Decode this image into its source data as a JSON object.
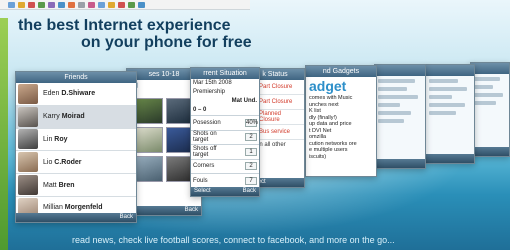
{
  "headline": {
    "line1": "the best Internet experience",
    "line2": "on your phone for free"
  },
  "footer": "read news, check live football scores, connect to facebook, and more on the go...",
  "friends_screen": {
    "title": "Friends",
    "back_label": "Back",
    "items": [
      {
        "first": "Eden",
        "last": "D.Shiware"
      },
      {
        "first": "Karry",
        "last": "Moirad"
      },
      {
        "first": "Lin",
        "last": "Roy"
      },
      {
        "first": "Lio",
        "last": "C.Roder"
      },
      {
        "first": "Matt",
        "last": "Bren"
      },
      {
        "first": "Millian",
        "last": "Morgenfeld"
      }
    ]
  },
  "photos_screen": {
    "title": "ses 10-18",
    "back_label": "Back"
  },
  "football_screen": {
    "title": "rrent Situation",
    "date": "Mar 15th 2008",
    "league": "Premiership",
    "teams_label": "Mat Und.",
    "score": "0 – 0",
    "stats": [
      {
        "label": "Posession",
        "value": "40%"
      },
      {
        "label": "Shots on target",
        "value": "2"
      },
      {
        "label": "Shots off target",
        "value": "1"
      },
      {
        "label": "Corners",
        "value": "2"
      },
      {
        "label": "Fouls",
        "value": "7"
      }
    ],
    "select_label": "Select",
    "back_label": "Back"
  },
  "status_screen": {
    "title": "k Status",
    "items": [
      {
        "text": "Part Closure",
        "color": "#cc3a2a"
      },
      {
        "text": "Part Closure",
        "color": "#e08a2a"
      },
      {
        "text": "Planned Closure",
        "color": "#3a73c8"
      },
      {
        "text": "Bus service",
        "color": "#7a3fa6"
      }
    ],
    "more": "ce on all other",
    "select_label": "Select"
  },
  "gadget_screen": {
    "title": "nd Gadgets",
    "logo": "adget",
    "lines": [
      "comes with Music",
      "unches next",
      "K list",
      "dly (finally!)",
      "up data and price",
      "t DVI Net",
      "omzilla",
      "cution networks ore",
      "e multiple users",
      "iscuits)"
    ]
  },
  "colors": {
    "headline": "#123f5e",
    "accent_blue": "#2d8fc9"
  }
}
